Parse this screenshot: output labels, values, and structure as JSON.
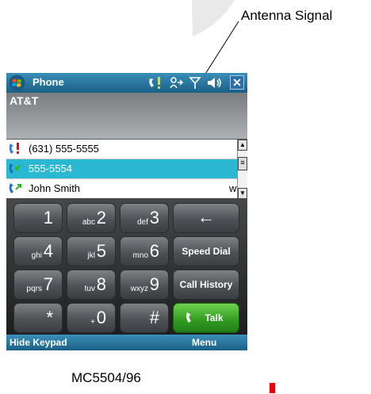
{
  "callout": {
    "label": "Antenna Signal"
  },
  "titlebar": {
    "title": "Phone",
    "close_label": "✕"
  },
  "carrier": {
    "name": "AT&T"
  },
  "call_list": [
    {
      "icon": "missed-call-icon",
      "text": "(631) 555-5555",
      "selected": false
    },
    {
      "icon": "incoming-call-icon",
      "text": "555-5554",
      "selected": true
    },
    {
      "icon": "outgoing-call-icon",
      "text": "John Smith",
      "selected": false,
      "letter": "w"
    }
  ],
  "scrollbar": {
    "up": "▲",
    "down": "▼",
    "thumb": "≡"
  },
  "keypad": {
    "k1": {
      "main": "1",
      "sub": ""
    },
    "k2": {
      "main": "2",
      "sub": "abc"
    },
    "k3": {
      "main": "3",
      "sub": "def"
    },
    "k4": {
      "main": "4",
      "sub": "ghi"
    },
    "k5": {
      "main": "5",
      "sub": "jkl"
    },
    "k6": {
      "main": "6",
      "sub": "mno"
    },
    "k7": {
      "main": "7",
      "sub": "pqrs"
    },
    "k8": {
      "main": "8",
      "sub": "tuv"
    },
    "k9": {
      "main": "9",
      "sub": "wxyz"
    },
    "kstar": {
      "main": "*"
    },
    "k0": {
      "main": "0",
      "sub": "+"
    },
    "khash": {
      "main": "#"
    },
    "backspace": {
      "label": "←"
    },
    "speed_dial": {
      "label": "Speed Dial"
    },
    "call_history": {
      "label": "Call History"
    },
    "talk": {
      "label": "Talk"
    }
  },
  "softkeys": {
    "left": "Hide Keypad",
    "right": "Menu"
  },
  "caption": "MC5504/96",
  "colors": {
    "titlebar": "#1b5f86",
    "selection": "#2ab8d2",
    "talk": "#2f9a20",
    "redmark": "#e8000a"
  }
}
